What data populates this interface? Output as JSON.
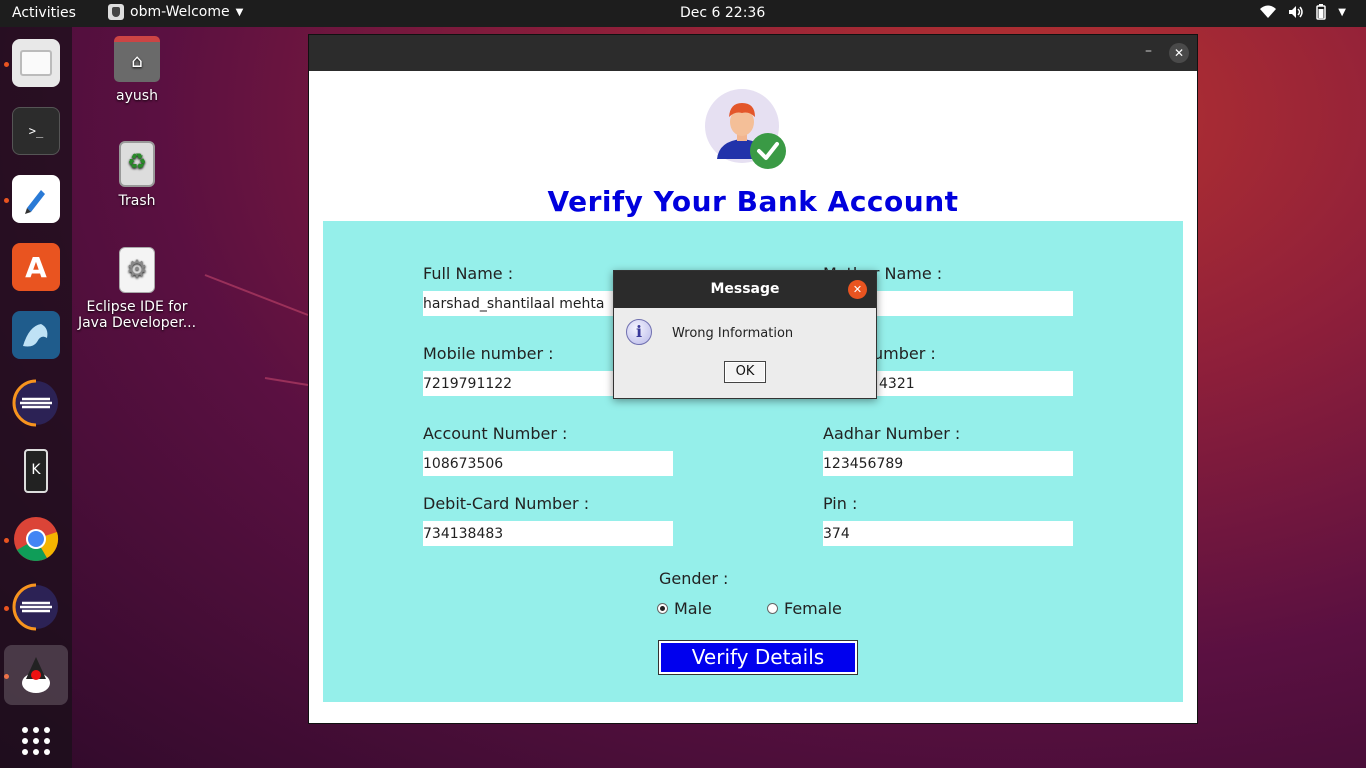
{
  "topbar": {
    "activities": "Activities",
    "app_name": "obm-Welcome",
    "clock": "Dec 6  22:36"
  },
  "dock": {
    "items": [
      "files-icon",
      "terminal-icon",
      "text-editor-icon",
      "software-center-icon",
      "mysql-workbench-icon",
      "eclipse-icon",
      "kde-connect-icon",
      "chrome-icon",
      "eclipse-icon-2",
      "java-app-icon",
      "show-apps-icon"
    ]
  },
  "desktop": {
    "icons": [
      {
        "label": "ayush"
      },
      {
        "label": "Trash"
      },
      {
        "label": "Eclipse IDE for Java Developer..."
      }
    ]
  },
  "window": {
    "title": "Verify Your Bank Account",
    "fields": {
      "full_name": {
        "label": "Full Name :",
        "value": "harshad_shantilaal mehta"
      },
      "mother_name": {
        "label": "Mother Name :",
        "value": ""
      },
      "mobile": {
        "label": "Mobile number :",
        "value": "7219791122"
      },
      "other_number": {
        "label": "umber :",
        "value": "4321"
      },
      "account": {
        "label": "Account Number :",
        "value": "108673506"
      },
      "aadhar": {
        "label": "Aadhar Number :",
        "value": "123456789"
      },
      "debit": {
        "label": "Debit-Card Number :",
        "value": "734138483"
      },
      "pin": {
        "label": "Pin :",
        "value": "374"
      }
    },
    "gender": {
      "label": "Gender :",
      "male": "Male",
      "female": "Female",
      "selected": "Male"
    },
    "verify_button": "Verify Details"
  },
  "dialog": {
    "title": "Message",
    "message": "Wrong Information",
    "ok": "OK"
  },
  "colors": {
    "title_blue": "#0000dd",
    "panel_bg": "#95efea",
    "button_blue": "#0000ee",
    "ubuntu_orange": "#e95420"
  }
}
